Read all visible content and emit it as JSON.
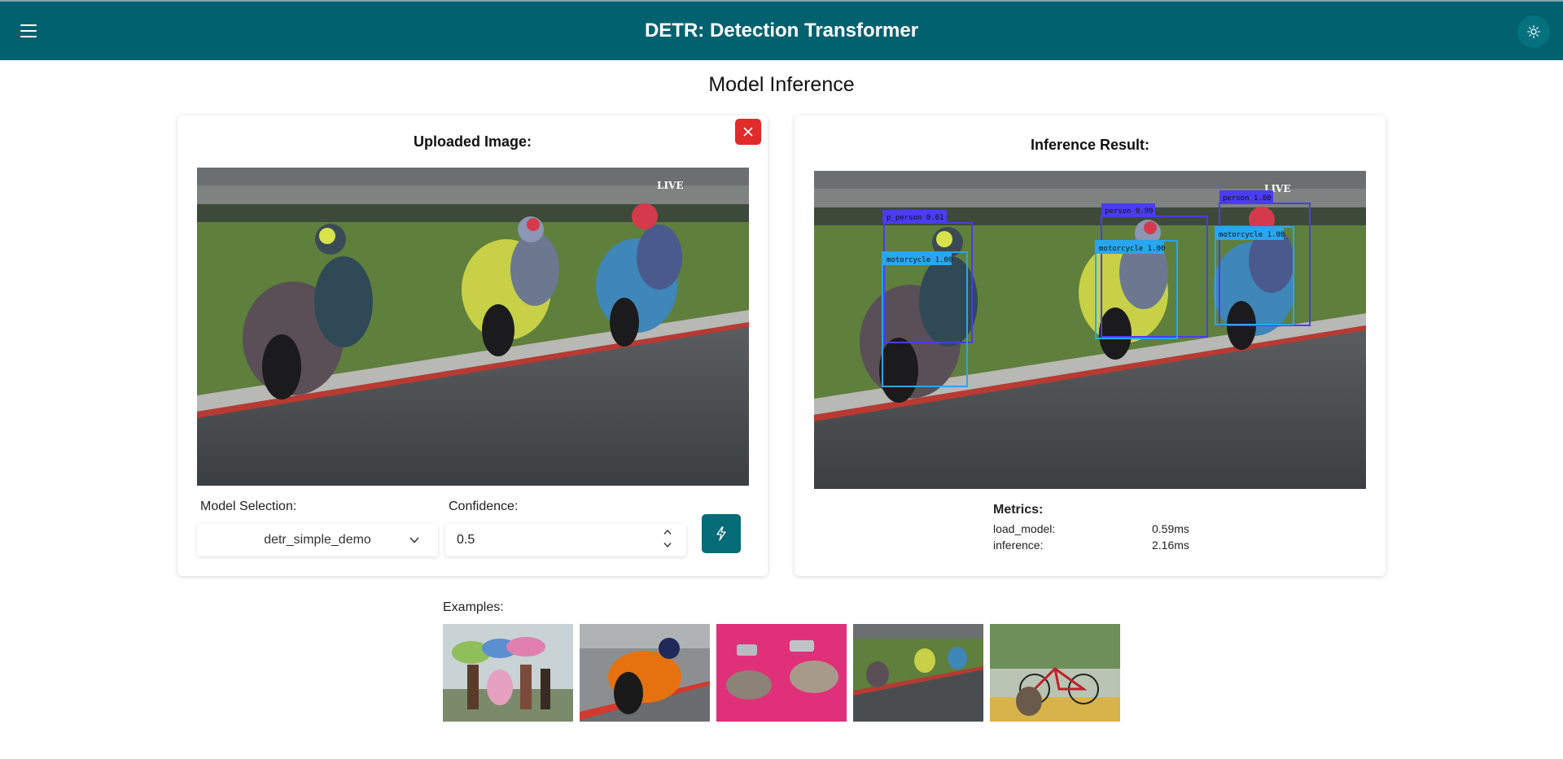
{
  "app": {
    "title": "DETR: Detection Transformer"
  },
  "icons": {
    "menu": "hamburger-menu-icon",
    "theme": "sun-icon",
    "close": "close-icon",
    "chevron": "chevron-down-icon",
    "run": "lightning-icon"
  },
  "page": {
    "title": "Model Inference"
  },
  "upload_panel": {
    "title": "Uploaded Image:",
    "model_label": "Model Selection:",
    "model_value": "detr_simple_demo",
    "confidence_label": "Confidence:",
    "confidence_value": "0.5"
  },
  "result_panel": {
    "title": "Inference Result:",
    "detections": [
      {
        "label": "p_person 0.61",
        "kind": "person"
      },
      {
        "label": "motorcycle 1.00",
        "kind": "motorcycle"
      },
      {
        "label": "person 0.99",
        "kind": "person"
      },
      {
        "label": "motorcycle 1.00",
        "kind": "motorcycle"
      },
      {
        "label": "person 1.00",
        "kind": "person"
      },
      {
        "label": "motorcycle 1.00",
        "kind": "motorcycle"
      }
    ],
    "metrics": {
      "title": "Metrics:",
      "rows": [
        {
          "name": "load_model:",
          "value": "0.59ms"
        },
        {
          "name": "inference:",
          "value": "2.16ms"
        }
      ]
    }
  },
  "examples": {
    "label": "Examples:",
    "items": [
      "umbrella-women-thumbnail",
      "motorcycle-rider-thumbnail",
      "cats-on-pink-thumbnail",
      "motogp-riders-thumbnail",
      "bicycle-dog-thumbnail"
    ]
  },
  "colors": {
    "header": "#02616f",
    "run_button": "#046b77",
    "close_button": "#e12a2a",
    "person_box": "#4a3cf0",
    "motorcycle_box": "#29a6ee"
  }
}
